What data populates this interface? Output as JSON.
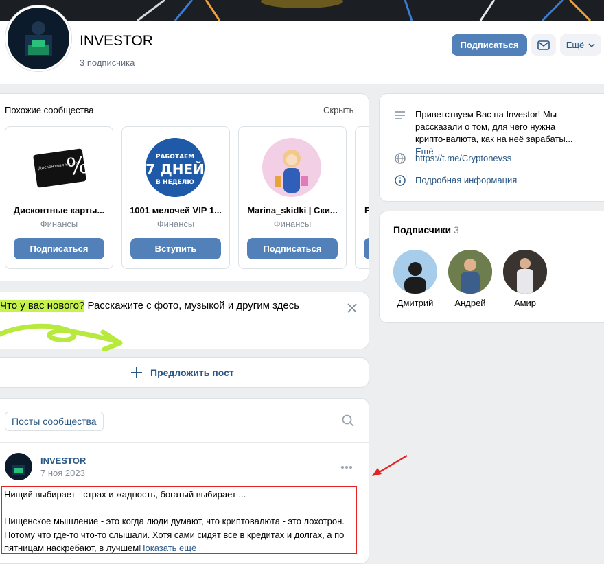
{
  "header": {
    "title": "INVESTOR",
    "subscribers": "3 подписчика",
    "subscribe_label": "Подписаться",
    "more_label": "Ещё"
  },
  "similar": {
    "title": "Похожие сообщества",
    "hide_label": "Скрыть",
    "items": [
      {
        "name": "Дисконтные карты...",
        "category": "Финансы",
        "button": "Подписаться",
        "logo_text": "Дисконтная карта"
      },
      {
        "name": "1001 мелочей VIP 1...",
        "category": "Финансы",
        "button": "Вступить",
        "logo_line1": "РАБОТАЕМ",
        "logo_line2": "7 ДНЕЙ",
        "logo_line3": "В НЕДЕЛЮ"
      },
      {
        "name": "Marina_skidki | Ски...",
        "category": "Финансы",
        "button": "Подписаться"
      },
      {
        "name": "F"
      }
    ]
  },
  "new_post": {
    "highlight": "Что у вас нового?",
    "text": " Расскажите с фото, музыкой и другим здесь"
  },
  "suggest": {
    "label": "Предложить пост"
  },
  "posts": {
    "tab_label": "Посты сообщества",
    "post": {
      "author": "INVESTOR",
      "date": "7 ноя 2023",
      "line1": "Нищий выбирает - страх и жадность, богатый выбирает ...",
      "line2": "Нищенское мышление - это когда люди думают, что криптовалюта - это лохотрон.",
      "line3": "Потому что где-то что-то слышали. Хотя сами сидят все в кредитах и долгах, а по",
      "line4": "пятницам наскребают, в лучшем",
      "show_more": "Показать ещё"
    }
  },
  "info": {
    "description": "Приветствуем Вас на Investor! Мы рассказали о том, для чего нужна крипто-валюта, как на неё зарабаты...",
    "description_more": "Ещё",
    "link": "https://t.me/Cryptonevss",
    "details": "Подробная информация"
  },
  "subscribers": {
    "title": "Подписчики",
    "count": "3",
    "people": [
      "Дмитрий",
      "Андрей",
      "Амир"
    ]
  },
  "colors": {
    "accent": "#5181b8",
    "link": "#2a5885",
    "highlight": "#c6f24e",
    "annotation": "#e52222"
  },
  "icons": [
    "mail-icon",
    "chevron-down-icon",
    "menu-lines-icon",
    "globe-icon",
    "info-icon",
    "close-icon",
    "plus-icon",
    "search-icon",
    "more-dots-icon",
    "arrow-annotation-icon"
  ]
}
